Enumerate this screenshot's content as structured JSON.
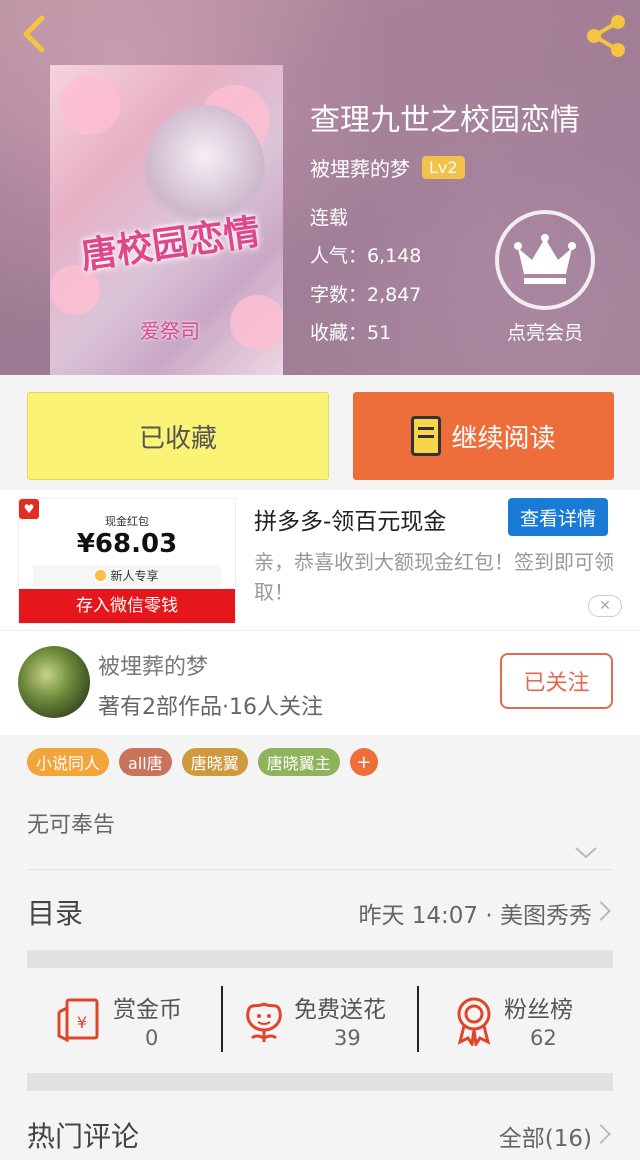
{
  "header": {
    "book_title": "查理九世之校园恋情",
    "author": "被埋葬的梦",
    "level": "Lv2",
    "status": "连载",
    "popularity": "人气：6,148",
    "word_count": "字数：2,847",
    "favorites": "收藏：51",
    "vip_label": "点亮会员",
    "icons": {
      "back": "back-chevron-icon",
      "share": "share-icon",
      "vip": "crown-icon"
    }
  },
  "cover": {
    "title_text": "唐校园恋情",
    "sub_text": "爱祭司"
  },
  "actions": {
    "collected_label": "已收藏",
    "continue_label": "继续阅读"
  },
  "ad": {
    "redpacket_label": "现金红包",
    "amount": "¥68.03",
    "new_user": "新人专享",
    "cta": "存入微信零钱",
    "title": "拼多多-领百元现金",
    "detail_button": "查看详情",
    "description": "亲，恭喜收到大额现金红包！签到即可领取！"
  },
  "author_card": {
    "name": "被埋葬的梦",
    "stats": "著有2部作品·16人关注",
    "follow_label": "已关注"
  },
  "tags": [
    {
      "label": "小说同人",
      "color": "#f2a53a"
    },
    {
      "label": "all唐",
      "color": "#c9735a"
    },
    {
      "label": "唐晓翼",
      "color": "#cf9a3e"
    },
    {
      "label": "唐晓翼主",
      "color": "#8fb35a"
    }
  ],
  "description": "无可奉告",
  "toc": {
    "label": "目录",
    "update": "昨天 14:07 · 美图秀秀"
  },
  "stats": [
    {
      "label": "赏金币",
      "value": "0",
      "icon": "red-envelope-icon"
    },
    {
      "label": "免费送花",
      "value": "39",
      "icon": "flower-icon"
    },
    {
      "label": "粉丝榜",
      "value": "62",
      "icon": "medal-icon"
    }
  ],
  "comments": {
    "label": "热门评论",
    "all": "全部(16)"
  },
  "colors": {
    "accent_orange": "#ee6e3b",
    "collected_yellow": "#fbf375",
    "ad_blue": "#1a7bd6",
    "ad_red": "#e6171c"
  }
}
